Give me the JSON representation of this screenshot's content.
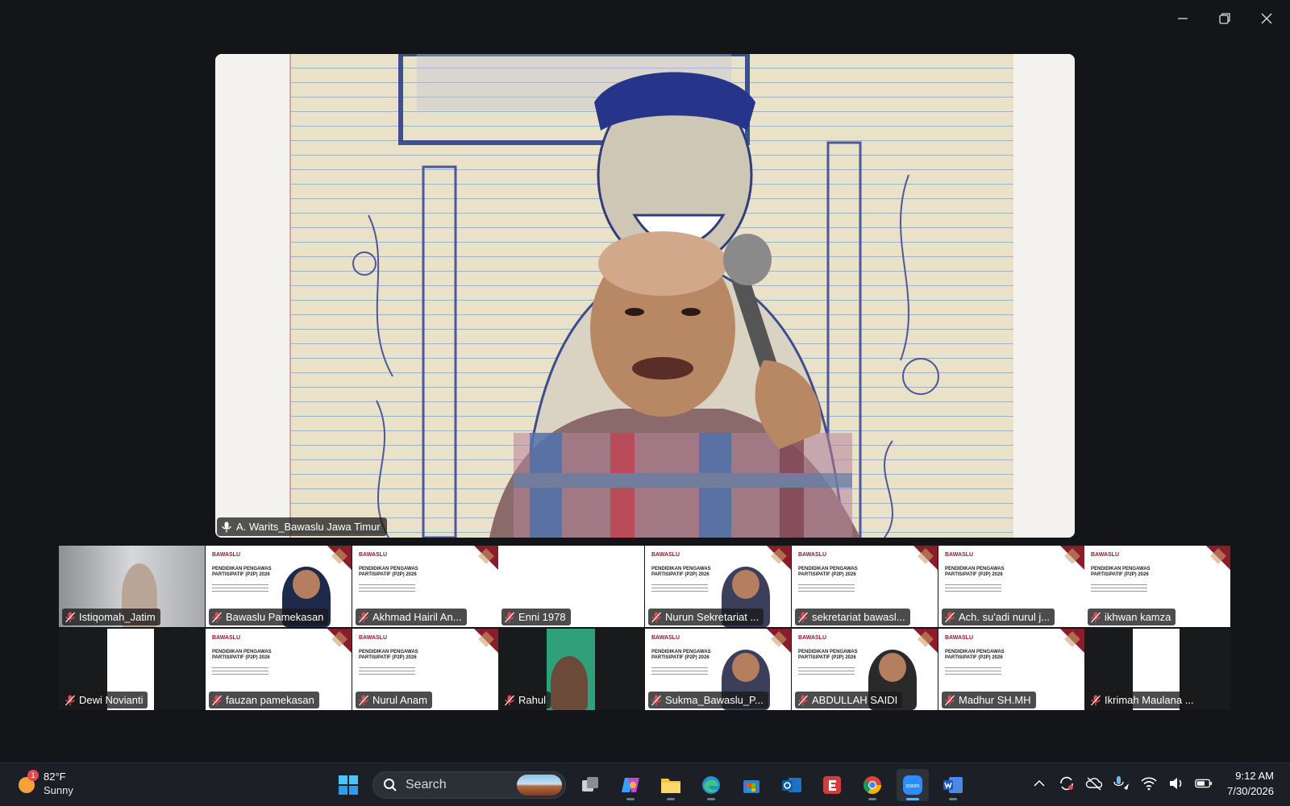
{
  "speaker": {
    "name": "A. Warits_Bawaslu Jawa Timur"
  },
  "slide": {
    "logo": "BAWASLU",
    "title": "PENDIDIKAN PENGAWAS PARTISIPATIF (P2P) 2026"
  },
  "participants": [
    {
      "name": "Istiqomah_Jatim",
      "type": "camera-woman"
    },
    {
      "name": "Bawaslu Pamekasan",
      "type": "slide-woman"
    },
    {
      "name": "Akhmad Hairil An...",
      "type": "slide"
    },
    {
      "name": "Enni 1978",
      "type": "slide-half"
    },
    {
      "name": "Nurun Sekretariat ...",
      "type": "slide-man"
    },
    {
      "name": "sekretariat bawasl...",
      "type": "slide"
    },
    {
      "name": "Ach. su'adi nurul j...",
      "type": "slide"
    },
    {
      "name": "ikhwan kamza",
      "type": "slide"
    },
    {
      "name": "Dewi Novianti",
      "type": "dark-slide"
    },
    {
      "name": "fauzan pamekasan",
      "type": "slide"
    },
    {
      "name": "Nurul Anam",
      "type": "slide"
    },
    {
      "name": "Rahul",
      "type": "green-man"
    },
    {
      "name": "Sukma_Bawaslu_P...",
      "type": "slide-man"
    },
    {
      "name": "ABDULLAH SAIDI",
      "type": "slide-man2"
    },
    {
      "name": "Madhur SH.MH",
      "type": "slide"
    },
    {
      "name": "Ikrimah Maulana ...",
      "type": "dark-slide"
    }
  ],
  "taskbar": {
    "weather": {
      "temp": "82°F",
      "condition": "Sunny",
      "badge": "1"
    },
    "search_label": "Search",
    "apps": [
      "task-view",
      "copilot",
      "file-explorer",
      "edge",
      "store",
      "outlook",
      "e-app",
      "chrome",
      "zoom",
      "word"
    ],
    "time": "9:12 AM",
    "date": "7/30/2026"
  },
  "colors": {
    "background": "#131518",
    "slide_accent": "#8b1d2a",
    "muted_red": "#e5484d",
    "active_app": "#5fb2ff"
  }
}
